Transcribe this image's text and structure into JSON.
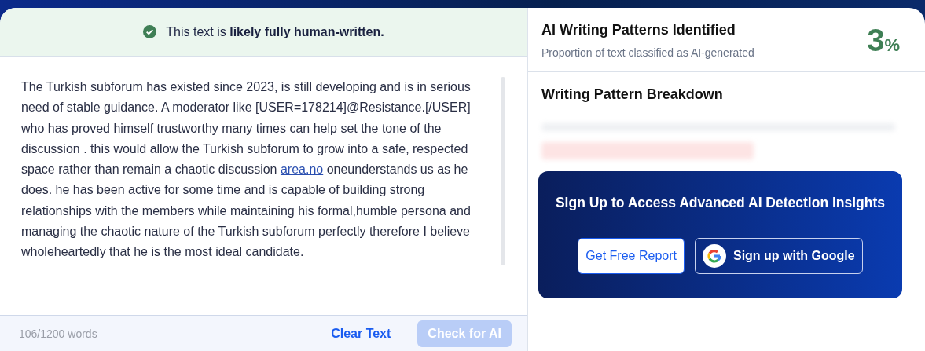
{
  "verdict": {
    "text": "This text is **likely fully human-written.**",
    "human_written": true
  },
  "editor": {
    "text_before": "The Turkish subforum has existed since 2023, is still developing and is in serious need of stable guidance. A moderator like [USER=178214]@Resistance.[/USER] who has proved himself trustworthy many times can help set the tone of the discussion . this would allow the Turkish subforum to grow into a safe, respected space rather than remain a chaotic discussion ",
    "link": "area.no",
    "text_after": " oneunderstands us as he does. he has been active for some time and is capable of building strong relationships with the members while maintaining his formal,humble persona and managing the chaotic nature of the Turkish subforum perfectly therefore I believe wholeheartedly that he is the most ideal candidate."
  },
  "footer": {
    "word_count": "106/1200 words",
    "clear_button": "Clear Text",
    "check_button": {
      "label": "Check for AI",
      "disabled": true
    }
  },
  "result": {
    "title": "AI Writing Patterns Identified",
    "subtitle": "Proportion of text classified as AI-generated",
    "score": "3",
    "unit": "%"
  },
  "breakdown": {
    "title": "Writing Pattern Breakdown"
  },
  "signup": {
    "title": "Sign Up to Access Advanced AI Detection Insights",
    "report_button": "Get Free Report",
    "google_button": "Sign up with Google"
  }
}
